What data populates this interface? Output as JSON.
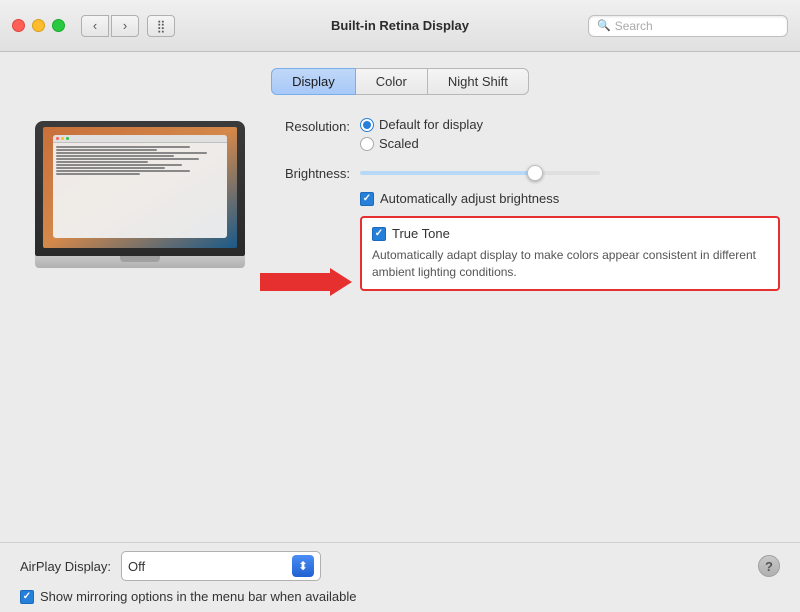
{
  "titlebar": {
    "title": "Built-in Retina Display",
    "search_placeholder": "Search"
  },
  "tabs": [
    {
      "id": "display",
      "label": "Display",
      "active": true
    },
    {
      "id": "color",
      "label": "Color",
      "active": false
    },
    {
      "id": "nightshift",
      "label": "Night Shift",
      "active": false
    }
  ],
  "resolution": {
    "label": "Resolution:",
    "options": [
      {
        "id": "default",
        "label": "Default for display",
        "selected": true
      },
      {
        "id": "scaled",
        "label": "Scaled",
        "selected": false
      }
    ]
  },
  "brightness": {
    "label": "Brightness:",
    "value": 75
  },
  "auto_brightness": {
    "label": "Automatically adjust brightness",
    "checked": true
  },
  "true_tone": {
    "label": "True Tone",
    "checked": true,
    "description": "Automatically adapt display to make colors appear consistent in different ambient lighting conditions."
  },
  "airplay": {
    "label": "AirPlay Display:",
    "value": "Off"
  },
  "mirroring": {
    "label": "Show mirroring options in the menu bar when available",
    "checked": true
  },
  "help": "?"
}
